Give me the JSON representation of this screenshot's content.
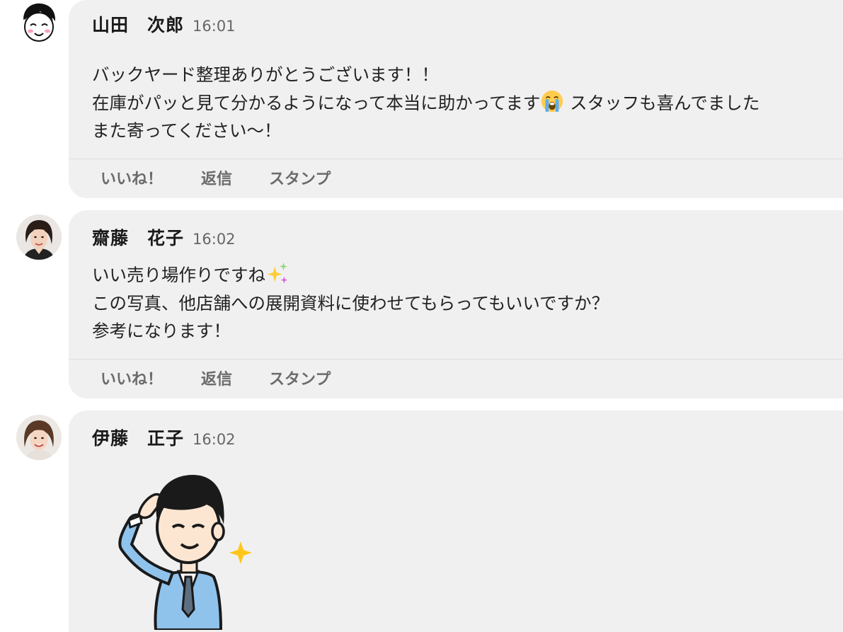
{
  "posts": [
    {
      "author": "山田　次郎",
      "time": "16:01",
      "lines": [
        "バックヤード整理ありがとうございます！！",
        "在庫がパッと見て分かるようになって本当に助かってます",
        "また寄ってください〜！"
      ],
      "line2_tail": " スタッフも喜んでました",
      "emoji": "crying-face-icon",
      "actions": [
        "いいね！",
        "返信",
        "スタンプ"
      ]
    },
    {
      "author": "齋藤　花子",
      "time": "16:02",
      "lines": [
        "いい売り場作りですね",
        "この写真、他店舗への展開資料に使わせてもらってもいいですか？",
        "参考になります！"
      ],
      "emoji": "sparkles-icon",
      "actions": [
        "いいね！",
        "返信",
        "スタンプ"
      ]
    },
    {
      "author": "伊藤　正子",
      "time": "16:02",
      "sticker": "saluting-businessman-sticker"
    }
  ],
  "colors": {
    "bubble": "#f0f0f0",
    "divider": "#dcdcdc",
    "action_text": "#6b6b6b",
    "suit": "#8fc3ec"
  }
}
